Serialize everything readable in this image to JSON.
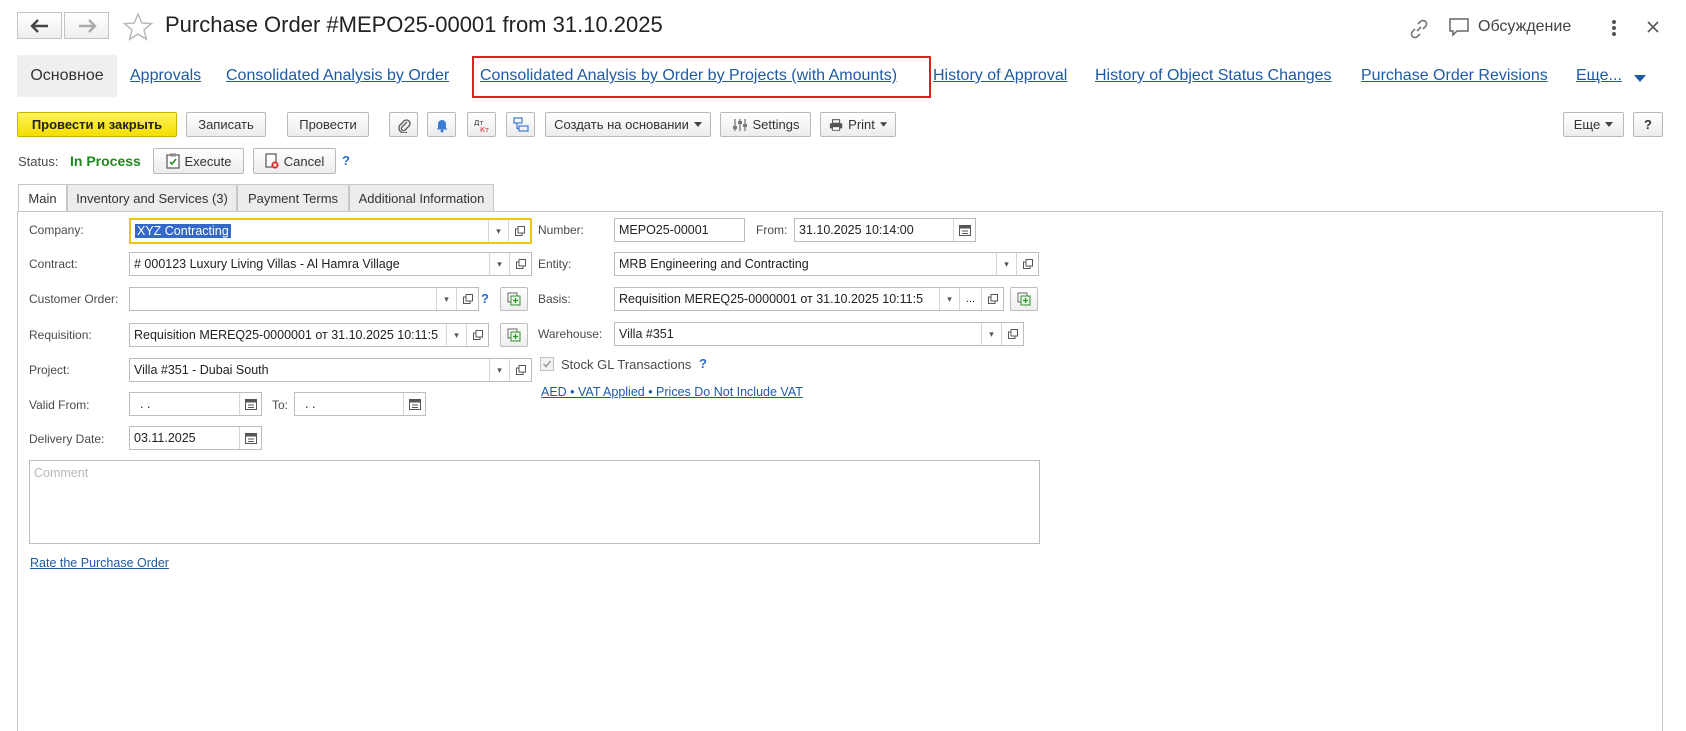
{
  "window": {
    "title": "Purchase Order #MEPO25-00001 from 31.10.2025",
    "discussion_label": "Обсуждение"
  },
  "top_tabs": [
    {
      "label": "Основное"
    },
    {
      "label": "Approvals"
    },
    {
      "label": "Consolidated Analysis by Order"
    },
    {
      "label": "Consolidated Analysis by Order by Projects (with Amounts)"
    },
    {
      "label": "History of Approval"
    },
    {
      "label": "History of Object Status Changes"
    },
    {
      "label": "Purchase Order Revisions"
    },
    {
      "label": "Еще..."
    }
  ],
  "toolbar": {
    "post_close": "Провести и закрыть",
    "save": "Записать",
    "post": "Провести",
    "create_based": "Создать на основании",
    "settings": "Settings",
    "print": "Print",
    "more": "Еще",
    "help": "?",
    "dtkt": "Дт Кт"
  },
  "status": {
    "label": "Status:",
    "value": "In Process",
    "execute": "Execute",
    "cancel": "Cancel",
    "help": "?"
  },
  "tabs": [
    {
      "label": "Main"
    },
    {
      "label": "Inventory and Services (3)"
    },
    {
      "label": "Payment Terms"
    },
    {
      "label": "Additional Information"
    }
  ],
  "form": {
    "company_label": "Company:",
    "company_value": "XYZ Contracting",
    "contract_label": "Contract:",
    "contract_value": "# 000123 Luxury Living Villas - Al Hamra Village",
    "customer_order_label": "Customer Order:",
    "customer_order_value": "",
    "customer_order_help": "?",
    "requisition_label": "Requisition:",
    "requisition_value": "Requisition MEREQ25-0000001 от 31.10.2025 10:11:5",
    "project_label": "Project:",
    "project_value": "Villa #351 - Dubai South",
    "valid_from_label": "Valid From:",
    "valid_from_value": " .  .",
    "to_label": "To:",
    "to_value": " .  .",
    "delivery_label": "Delivery Date:",
    "delivery_value": "03.11.2025",
    "number_label": "Number:",
    "number_value": "MEPO25-00001",
    "from_label": "From:",
    "from_value": "31.10.2025 10:14:00",
    "entity_label": "Entity:",
    "entity_value": "MRB Engineering and Contracting",
    "basis_label": "Basis:",
    "basis_value": "Requisition MEREQ25-0000001 от 31.10.2025 10:11:5",
    "warehouse_label": "Warehouse:",
    "warehouse_value": "Villa #351",
    "stock_gl_label": "Stock GL Transactions",
    "stock_gl_checked": true,
    "stock_gl_help": "?",
    "currency_link": "AED • VAT Applied • Prices Do Not Include VAT",
    "comment_placeholder": "Comment",
    "rate_link": "Rate the Purchase Order"
  },
  "colors": {
    "accent_link": "#1f5aa6",
    "status_green": "#1e8b1e",
    "primary_button": "#f4de00",
    "highlight_border": "#e02020",
    "selection": "#3367c8"
  }
}
